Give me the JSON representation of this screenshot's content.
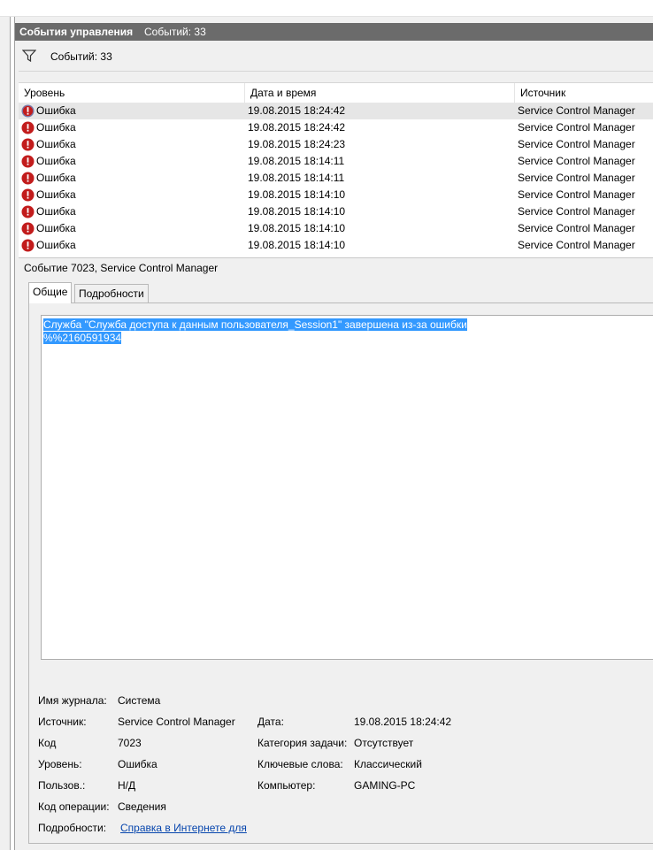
{
  "header": {
    "title": "События управления",
    "count_label": "Событий: 33"
  },
  "filter": {
    "text": "Событий: 33",
    "icon": "filter-funnel-icon"
  },
  "table": {
    "columns": [
      "Уровень",
      "Дата и время",
      "Источник"
    ],
    "rows": [
      {
        "level": "Ошибка",
        "datetime": "19.08.2015 18:24:42",
        "source": "Service Control Manager",
        "selected": true
      },
      {
        "level": "Ошибка",
        "datetime": "19.08.2015 18:24:42",
        "source": "Service Control Manager"
      },
      {
        "level": "Ошибка",
        "datetime": "19.08.2015 18:24:23",
        "source": "Service Control Manager"
      },
      {
        "level": "Ошибка",
        "datetime": "19.08.2015 18:14:11",
        "source": "Service Control Manager"
      },
      {
        "level": "Ошибка",
        "datetime": "19.08.2015 18:14:11",
        "source": "Service Control Manager"
      },
      {
        "level": "Ошибка",
        "datetime": "19.08.2015 18:14:10",
        "source": "Service Control Manager"
      },
      {
        "level": "Ошибка",
        "datetime": "19.08.2015 18:14:10",
        "source": "Service Control Manager"
      },
      {
        "level": "Ошибка",
        "datetime": "19.08.2015 18:14:10",
        "source": "Service Control Manager"
      },
      {
        "level": "Ошибка",
        "datetime": "19.08.2015 18:14:10",
        "source": "Service Control Manager"
      }
    ]
  },
  "detail": {
    "title": "Событие 7023, Service Control Manager",
    "tabs": [
      "Общие",
      "Подробности"
    ],
    "message_line1": "Служба \"Служба доступа к данным пользователя_Session1\" завершена из-за ошибки",
    "message_line2": "%%2160591934",
    "props": {
      "log_name_label": "Имя журнала:",
      "log_name": "Система",
      "source_label": "Источник:",
      "source": "Service Control Manager",
      "date_label": "Дата:",
      "date": "19.08.2015 18:24:42",
      "code_label": "Код",
      "code": "7023",
      "task_category_label": "Категория задачи:",
      "task_category": "Отсутствует",
      "level_label": "Уровень:",
      "level": "Ошибка",
      "keywords_label": "Ключевые слова:",
      "keywords": "Классический",
      "user_label": "Пользов.:",
      "user": "Н/Д",
      "computer_label": "Компьютер:",
      "computer": "GAMING-PC",
      "opcode_label": "Код операции:",
      "opcode": "Сведения",
      "more_label": "Подробности:",
      "more_link": "Справка в Интернете для"
    }
  },
  "colors": {
    "title_bar": "#6b6b6b",
    "selection": "#3399ff",
    "error_icon": "#c21c1c",
    "link": "#0645ad"
  }
}
